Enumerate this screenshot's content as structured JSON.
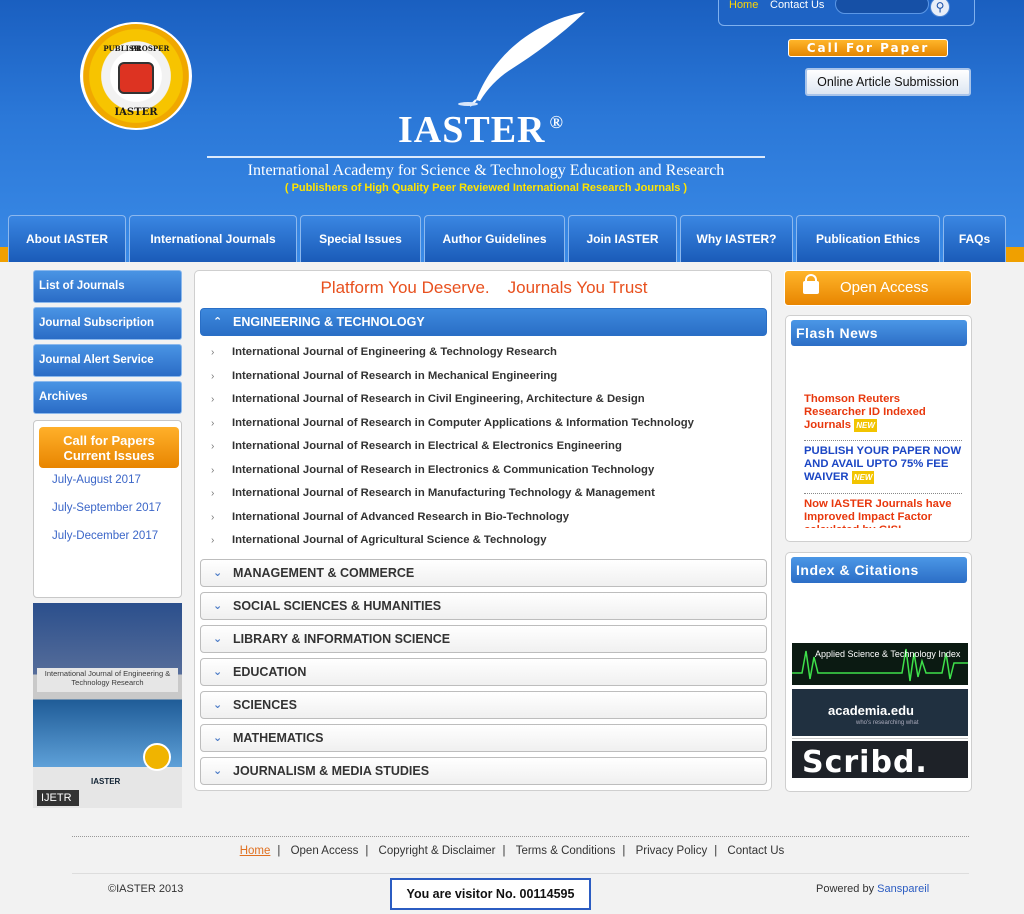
{
  "top": {
    "home": "Home",
    "contact": "Contact Us",
    "search_icon": "magnifier-icon"
  },
  "header": {
    "call_for_paper": "Call For Paper",
    "online_submission": "Online Article Submission",
    "brand": "IASTER",
    "registered": "®",
    "subtitle": "International Academy for Science & Technology Education and Research",
    "tagline": "( Publishers of High Quality Peer Reviewed International Research Journals )",
    "logo_top_left": "PUBLISH",
    "logo_top_right": "PROSPER",
    "logo_bottom": "IASTER"
  },
  "nav": [
    "About IASTER",
    "International Journals",
    "Special Issues",
    "Author Guidelines",
    "Join IASTER",
    "Why IASTER?",
    "Publication Ethics",
    "FAQs"
  ],
  "sidebar": {
    "items": [
      "List of Journals",
      "Journal Subscription",
      "Journal Alert Service",
      "Archives"
    ],
    "cfp_title": "Call for Papers Current Issues",
    "issues": [
      "July-August 2017",
      "July-September 2017",
      "July-December 2017"
    ],
    "cover_title": "International Journal of Engineering & Technology Research",
    "cover_brand": "IASTER",
    "cover_label": "IJETR"
  },
  "main": {
    "slogan_a": "Platform You Deserve.",
    "slogan_b": "Journals You Trust",
    "sections": [
      "ENGINEERING & TECHNOLOGY",
      "MANAGEMENT & COMMERCE",
      "SOCIAL SCIENCES & HUMANITIES",
      "LIBRARY & INFORMATION SCIENCE",
      "EDUCATION",
      "SCIENCES",
      "MATHEMATICS",
      "JOURNALISM & MEDIA STUDIES"
    ],
    "journals": [
      "International Journal of Engineering & Technology Research",
      "International Journal of Research in Mechanical Engineering",
      "International Journal of Research in Civil Engineering, Architecture & Design",
      "International Journal of Research in Computer Applications & Information Technology",
      "International Journal of Research in Electrical & Electronics Engineering",
      "International Journal of Research in Electronics & Communication Technology",
      "International Journal of Research in Manufacturing Technology & Management",
      "International Journal of Advanced Research in Bio-Technology",
      "International Journal of Agricultural Science & Technology"
    ]
  },
  "right": {
    "open_access": "Open Access",
    "flash_title": "Flash News",
    "news": [
      "Thomson Reuters Researcher ID Indexed Journals",
      "PUBLISH YOUR PAPER NOW AND AVAIL UPTO 75% FEE WAIVER",
      "Now IASTER Journals have Improved Impact Factor calculated by GISI"
    ],
    "new_tag": "NEW",
    "index_title": "Index & Citations",
    "b1": "Applied Science & Technology Index",
    "b2": "academia.edu",
    "b2s": "who's researching what",
    "b3": "Scribd."
  },
  "footer": {
    "links": [
      "Home",
      "Open Access",
      "Copyright & Disclaimer",
      "Terms & Conditions",
      "Privacy Policy",
      "Contact Us"
    ],
    "sep": "|",
    "copyright": "©IASTER 2013",
    "visitor": "You are visitor No. 00114595",
    "powered": "Powered by",
    "powered_by": "Sanspareil"
  }
}
